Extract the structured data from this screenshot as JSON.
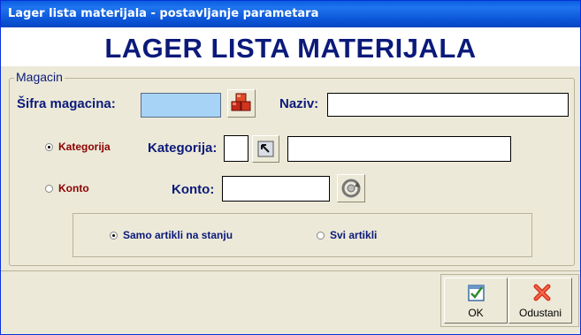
{
  "window": {
    "title": "Lager lista materijala - postavljanje parametara"
  },
  "banner": {
    "heading": "LAGER LISTA MATERIJALA"
  },
  "group": {
    "label": "Magacin"
  },
  "form": {
    "sifra_label": "Šifra magacina:",
    "sifra_value": "",
    "naziv_label": "Naziv:",
    "naziv_value": "",
    "kategorija_radio": "Kategorija",
    "kategorija_label": "Kategorija:",
    "kategorija_code": "",
    "kategorija_name": "",
    "konto_radio": "Konto",
    "konto_label": "Konto:",
    "konto_value": ""
  },
  "filter": {
    "samo_label": "Samo artikli na stanju",
    "svi_label": "Svi artikli"
  },
  "buttons": {
    "ok": "OK",
    "cancel": "Odustani"
  },
  "colors": {
    "label_blue": "#0b1a7a",
    "radio_red": "#8b0000",
    "highlight": "#a7d3f7"
  }
}
